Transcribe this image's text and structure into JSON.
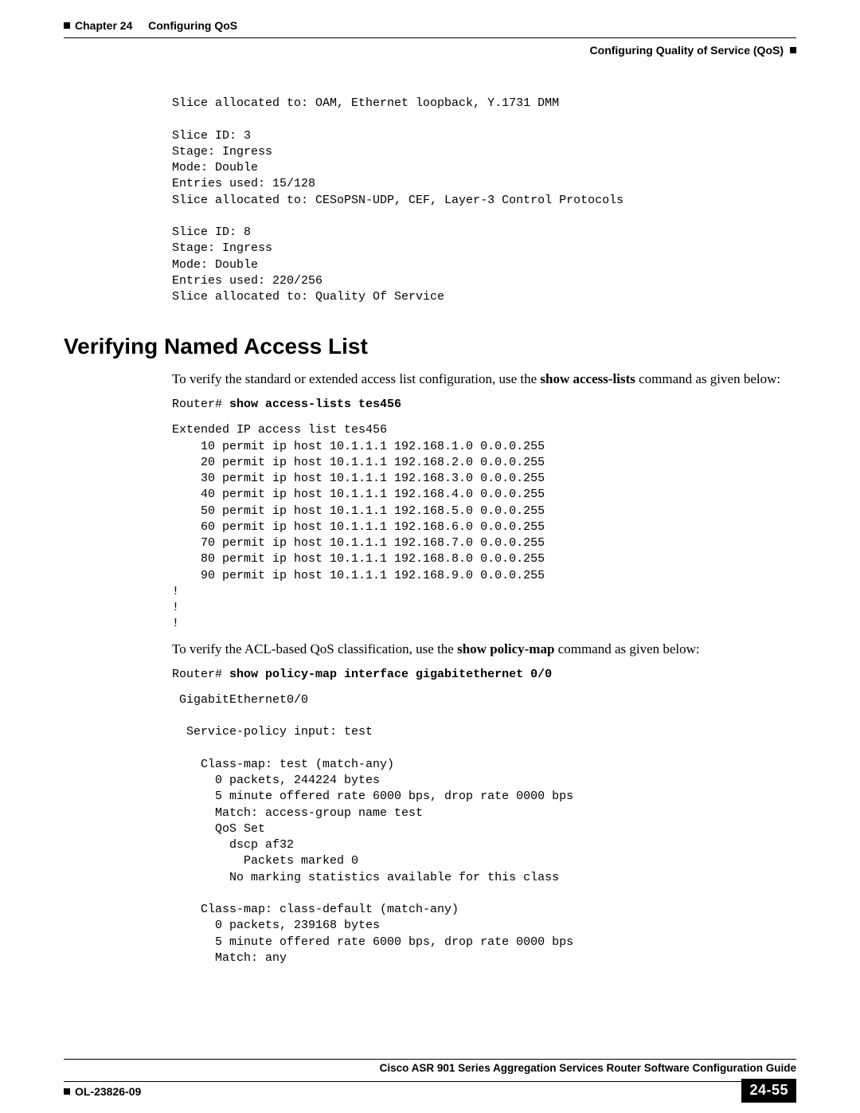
{
  "header": {
    "chapter_label": "Chapter 24",
    "chapter_title": "Configuring QoS",
    "section_path": "Configuring Quality of Service (QoS)"
  },
  "pre_section_code": "Slice allocated to: OAM, Ethernet loopback, Y.1731 DMM\n\nSlice ID: 3\nStage: Ingress\nMode: Double\nEntries used: 15/128\nSlice allocated to: CESoPSN-UDP, CEF, Layer-3 Control Protocols\n\nSlice ID: 8\nStage: Ingress\nMode: Double\nEntries used: 220/256\nSlice allocated to: Quality Of Service",
  "section": {
    "heading": "Verifying Named Access List",
    "para1_pre": "To verify the standard or extended access list configuration, use the ",
    "para1_bold": "show access-lists",
    "para1_post": " command as given below:",
    "cmd1_prompt": "Router# ",
    "cmd1_cmd": "show access-lists tes456",
    "acl_output": "Extended IP access list tes456\n    10 permit ip host 10.1.1.1 192.168.1.0 0.0.0.255\n    20 permit ip host 10.1.1.1 192.168.2.0 0.0.0.255\n    30 permit ip host 10.1.1.1 192.168.3.0 0.0.0.255\n    40 permit ip host 10.1.1.1 192.168.4.0 0.0.0.255\n    50 permit ip host 10.1.1.1 192.168.5.0 0.0.0.255\n    60 permit ip host 10.1.1.1 192.168.6.0 0.0.0.255\n    70 permit ip host 10.1.1.1 192.168.7.0 0.0.0.255\n    80 permit ip host 10.1.1.1 192.168.8.0 0.0.0.255\n    90 permit ip host 10.1.1.1 192.168.9.0 0.0.0.255\n!\n!\n!",
    "para2_pre": "To verify the ACL-based QoS classification, use the ",
    "para2_bold": "show policy-map",
    "para2_post": " command as given below:",
    "cmd2_prompt": "Router# ",
    "cmd2_cmd": "show policy-map interface gigabitethernet 0/0",
    "policy_output": " GigabitEthernet0/0\n\n  Service-policy input: test\n\n    Class-map: test (match-any)\n      0 packets, 244224 bytes\n      5 minute offered rate 6000 bps, drop rate 0000 bps\n      Match: access-group name test\n      QoS Set\n        dscp af32\n          Packets marked 0\n        No marking statistics available for this class\n\n    Class-map: class-default (match-any)\n      0 packets, 239168 bytes\n      5 minute offered rate 6000 bps, drop rate 0000 bps\n      Match: any"
  },
  "footer": {
    "guide_title": "Cisco ASR 901 Series Aggregation Services Router Software Configuration Guide",
    "doc_id": "OL-23826-09",
    "page_number": "24-55"
  }
}
